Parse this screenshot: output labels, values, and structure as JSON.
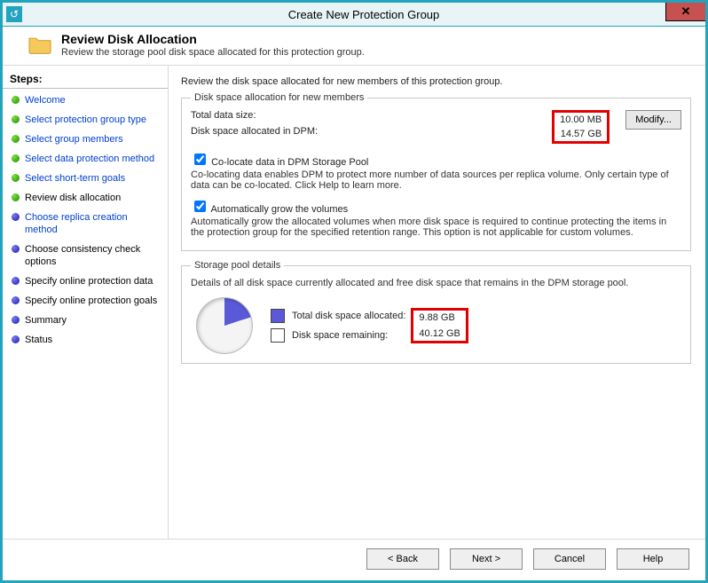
{
  "window": {
    "title": "Create New Protection Group"
  },
  "header": {
    "title": "Review Disk Allocation",
    "subtitle": "Review the storage pool disk space allocated for this protection group."
  },
  "steps": {
    "header": "Steps:",
    "items": [
      "Welcome",
      "Select protection group type",
      "Select group members",
      "Select data protection method",
      "Select short-term goals",
      "Review disk allocation",
      "Choose replica creation method",
      "Choose consistency check options",
      "Specify online protection data",
      "Specify online protection goals",
      "Summary",
      "Status"
    ]
  },
  "content": {
    "intro": "Review the disk space allocated for new members of this protection group.",
    "allocation": {
      "legend": "Disk space allocation for new members",
      "total_label": "Total data size:",
      "total_value": "10.00 MB",
      "dpm_label": "Disk space allocated in DPM:",
      "dpm_value": "14.57 GB",
      "modify_label": "Modify..."
    },
    "colocate": {
      "label": "Co-locate data in DPM Storage Pool",
      "desc": "Co-locating data enables DPM to protect more number of data sources per replica volume. Only certain type of data can be co-located. Click Help to learn more."
    },
    "autogrow": {
      "label": "Automatically grow the volumes",
      "desc": "Automatically grow the allocated volumes when more disk space is required to continue protecting the items in the protection group for the specified retention range. This option is not applicable for custom volumes."
    },
    "pool": {
      "legend": "Storage pool details",
      "desc": "Details of all disk space currently allocated and free disk space that remains in the DPM storage pool.",
      "allocated_label": "Total disk space allocated:",
      "allocated_value": "9.88 GB",
      "remaining_label": "Disk space remaining:",
      "remaining_value": "40.12 GB"
    }
  },
  "buttons": {
    "back": "< Back",
    "next": "Next >",
    "cancel": "Cancel",
    "help": "Help"
  },
  "chart_data": {
    "type": "pie",
    "title": "Storage pool details",
    "series": [
      {
        "name": "Total disk space allocated",
        "value": 9.88,
        "unit": "GB",
        "color": "#5a5ad8"
      },
      {
        "name": "Disk space remaining",
        "value": 40.12,
        "unit": "GB",
        "color": "#f4f4f4"
      }
    ]
  }
}
